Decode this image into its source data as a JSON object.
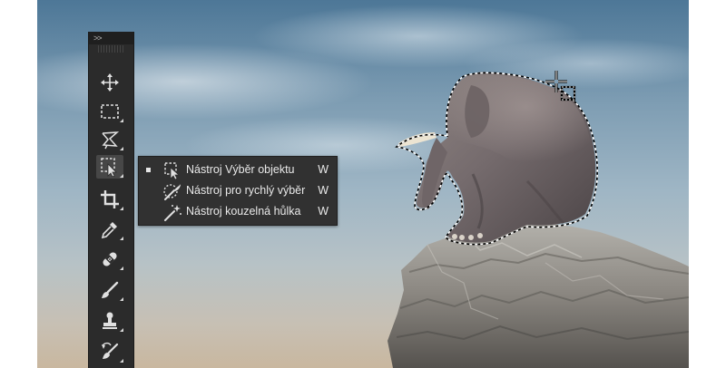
{
  "panel": {
    "collapse_label": ">>",
    "tools": [
      {
        "name": "move-tool",
        "icon": "move-icon"
      },
      {
        "name": "rectangular-marquee-tool",
        "icon": "rectangular-marquee-icon"
      },
      {
        "name": "lasso-tool",
        "icon": "polygonal-lasso-icon"
      },
      {
        "name": "object-selection-tool",
        "icon": "object-selection-icon",
        "active": true
      },
      {
        "name": "crop-tool",
        "icon": "crop-icon"
      },
      {
        "name": "eyedropper-tool",
        "icon": "eyedropper-icon"
      },
      {
        "name": "healing-brush-tool",
        "icon": "healing-bandage-icon"
      },
      {
        "name": "brush-tool",
        "icon": "brush-icon"
      },
      {
        "name": "clone-stamp-tool",
        "icon": "stamp-icon"
      },
      {
        "name": "history-brush-tool",
        "icon": "history-brush-icon"
      }
    ]
  },
  "flyout": {
    "items": [
      {
        "label": "Nástroj Výběr objektu",
        "shortcut": "W",
        "icon": "object-selection-icon",
        "selected": true
      },
      {
        "label": "Nástroj pro rychlý výběr",
        "shortcut": "W",
        "icon": "quick-selection-icon",
        "selected": false
      },
      {
        "label": "Nástroj kouzelná hůlka",
        "shortcut": "W",
        "icon": "magic-wand-icon",
        "selected": false
      }
    ]
  },
  "canvas": {
    "subject": "elephant",
    "cursor": "object-selection-crosshair-icon"
  },
  "colors": {
    "panel_bg": "#2b2b2b",
    "flyout_bg": "#313131",
    "icon": "#e0e0e0",
    "active_tool_bg": "#474747"
  }
}
